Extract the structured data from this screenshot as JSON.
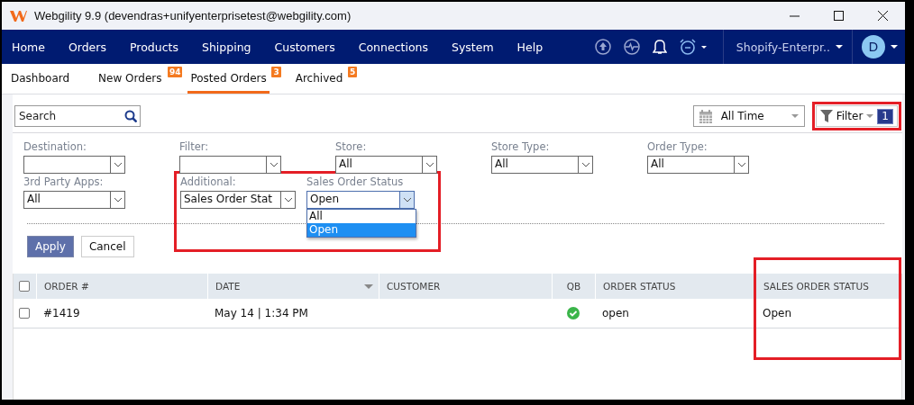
{
  "window": {
    "title": "Webgility 9.9 (devendras+unifyenterprisetest@webgility.com)"
  },
  "nav": {
    "items": [
      "Home",
      "Orders",
      "Products",
      "Shipping",
      "Customers",
      "Connections",
      "System",
      "Help"
    ],
    "store": "Shopify-Enterpr..",
    "avatar": "D"
  },
  "tabs": [
    {
      "label": "Dashboard",
      "selected": false
    },
    {
      "label": "New Orders",
      "badge": "94",
      "selected": false
    },
    {
      "label": "Posted Orders",
      "badge": "3",
      "selected": true
    },
    {
      "label": "Archived",
      "badge": "5",
      "selected": false
    }
  ],
  "toolbar": {
    "search": {
      "placeholder": "Search"
    },
    "date_range": "All Time",
    "filter": {
      "label": "Filter",
      "count": "1",
      "highlighted": true
    }
  },
  "filters": {
    "rows": [
      [
        {
          "label": "Destination:"
        },
        {
          "label": "Filter:"
        },
        {
          "label": "Store:",
          "value": "All"
        },
        {
          "label": "Store Type:",
          "value": "All"
        },
        {
          "label": "Order Type:",
          "value": "All"
        }
      ],
      [
        {
          "label": "3rd Party Apps:",
          "value": "All"
        },
        {
          "kind": "group",
          "highlighted": true,
          "fields": [
            {
              "label": "Additional:",
              "value": "Sales Order Stat"
            },
            {
              "label": "Sales Order Status",
              "value": "Open",
              "open": true,
              "options": [
                {
                  "label": "All",
                  "selected": false
                },
                {
                  "label": "Open",
                  "selected": true
                }
              ]
            }
          ]
        }
      ]
    ],
    "buttons": [
      {
        "label": "Apply",
        "kind": "primary"
      },
      {
        "label": "Cancel",
        "kind": "secondary"
      }
    ]
  },
  "table": {
    "all_checked": false,
    "columns": [
      {
        "label": "ORDER #"
      },
      {
        "label": "DATE",
        "sorted": true
      },
      {
        "label": "CUSTOMER"
      },
      {
        "label": "QB",
        "kind": "icon"
      },
      {
        "label": "ORDER STATUS"
      },
      {
        "label": "SALES ORDER STATUS",
        "highlighted": true
      }
    ],
    "rows": [
      {
        "checked": false,
        "cells": [
          {
            "kind": "text",
            "text": "#1419"
          },
          {
            "kind": "text",
            "text": "May 14 | 1:34 PM"
          },
          {
            "kind": "blank"
          },
          {
            "kind": "synced",
            "synced": true
          },
          {
            "kind": "text",
            "text": "open"
          },
          {
            "kind": "text",
            "text": "Open"
          }
        ]
      }
    ]
  }
}
